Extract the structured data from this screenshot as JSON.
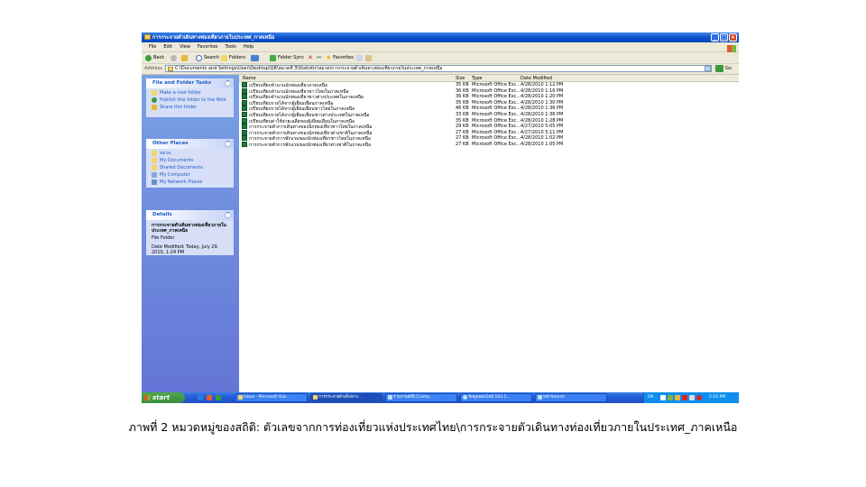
{
  "window": {
    "title": "การกระจายตัวเดินทางท่องเที่ยวภายในประเทศ_ภาคเหนือ"
  },
  "menu": [
    "File",
    "Edit",
    "View",
    "Favorites",
    "Tools",
    "Help"
  ],
  "toolbar": {
    "back": "Back",
    "search": "Search",
    "folders": "Folders",
    "folder_sync": "Folder Sync",
    "favorites": "Favorites"
  },
  "address": {
    "label": "Address",
    "path": "C:\\Documents and Settings\\User\\Desktop\\QR\\หมวดที่ 3\\Statistic\\หมวด\\การกระจายตัวเดินทางท่องเที่ยวภายในประเทศ_ภาคเหนือ",
    "go": "Go"
  },
  "tasks": {
    "title": "File and Folder Tasks",
    "items": [
      "Make a new folder",
      "Publish this folder to the Web",
      "Share this folder"
    ]
  },
  "places": {
    "title": "Other Places",
    "items": [
      "หมวด",
      "My Documents",
      "Shared Documents",
      "My Computer",
      "My Network Places"
    ]
  },
  "details": {
    "title": "Details",
    "name": "การกระจายตัวเดินทางท่องเที่ยวภายในประเทศ_ภาคเหนือ",
    "type": "File Folder",
    "modified": "Date Modified: Today, July 29, 2010, 1:24 PM"
  },
  "columns": {
    "name": "Name",
    "size": "Size",
    "type": "Type",
    "date": "Date Modified"
  },
  "files": [
    {
      "name": "เปรียบเทียบจำนวนนักท่องเที่ยวภาคเหนือ",
      "size": "35 KB",
      "type": "Microsoft Office Exc...",
      "date": "4/28/2010 1:12 PM"
    },
    {
      "name": "เปรียบเทียบจำนวนนักท่องเที่ยวชาวไทยในภาคเหนือ",
      "size": "36 KB",
      "type": "Microsoft Office Exc...",
      "date": "4/28/2010 1:16 PM"
    },
    {
      "name": "เปรียบเทียบจำนวนนักท่องเที่ยวชาวต่างประเทศในภาคเหนือ",
      "size": "36 KB",
      "type": "Microsoft Office Exc...",
      "date": "4/28/2010 1:20 PM"
    },
    {
      "name": "เปรียบเทียบรายได้จากผู้เยี่ยมเยือนภาคเหนือ",
      "size": "35 KB",
      "type": "Microsoft Office Exc...",
      "date": "4/28/2010 1:30 PM"
    },
    {
      "name": "เปรียบเทียบรายได้จากผู้เยี่ยมเยือนชาวไทยในภาคเหนือ",
      "size": "46 KB",
      "type": "Microsoft Office Exc...",
      "date": "4/28/2010 1:36 PM"
    },
    {
      "name": "เปรียบเทียบรายได้จากผู้เยี่ยมเยือนชาวต่างประเทศในภาคเหนือ",
      "size": "33 KB",
      "type": "Microsoft Office Exc...",
      "date": "4/28/2010 1:36 PM"
    },
    {
      "name": "เปรียบเทียบค่าใช้จ่ายเฉลี่ยของผู้เยี่ยมเยือนในภาคเหนือ",
      "size": "35 KB",
      "type": "Microsoft Office Exc...",
      "date": "4/28/2010 1:28 PM"
    },
    {
      "name": "การกระจายตัวการเดินทางของนักท่องเที่ยวชาวไทยในภาคเหนือ",
      "size": "29 KB",
      "type": "Microsoft Office Exc...",
      "date": "4/27/2010 5:05 PM"
    },
    {
      "name": "การกระจายตัวการเดินทางของนักท่องเที่ยวต่างชาติในภาคเหนือ",
      "size": "27 KB",
      "type": "Microsoft Office Exc...",
      "date": "4/27/2010 5:11 PM"
    },
    {
      "name": "การกระจายตัวการพักแรมของนักท่องเที่ยวชาวไทยในภาคเหนือ",
      "size": "27 KB",
      "type": "Microsoft Office Exc...",
      "date": "4/28/2010 1:02 PM"
    },
    {
      "name": "การกระจายตัวการพักแรมของนักท่องเที่ยวต่างชาติในภาคเหนือ",
      "size": "27 KB",
      "type": "Microsoft Office Exc...",
      "date": "4/28/2010 1:05 PM"
    }
  ],
  "taskbar": {
    "start": "start",
    "buttons": [
      "Inbox - Microsoft Out...",
      "การกระจายตัวเดินทาง...",
      "รายงานสถิติ [Comp...",
      "ข้อมูลออนไลน์ 103.5...",
      "หน้าSearch"
    ],
    "lang": "EN",
    "clock": "2:10 PM"
  },
  "caption": "ภาพที่ 2 หมวดหมู่ของสถิติ: ตัวเลขจากการท่องเที่ยวแห่งประเทศไทย\\การกระจายตัวเดินทางท่องเที่ยวภายในประเทศ_ภาคเหนือ"
}
